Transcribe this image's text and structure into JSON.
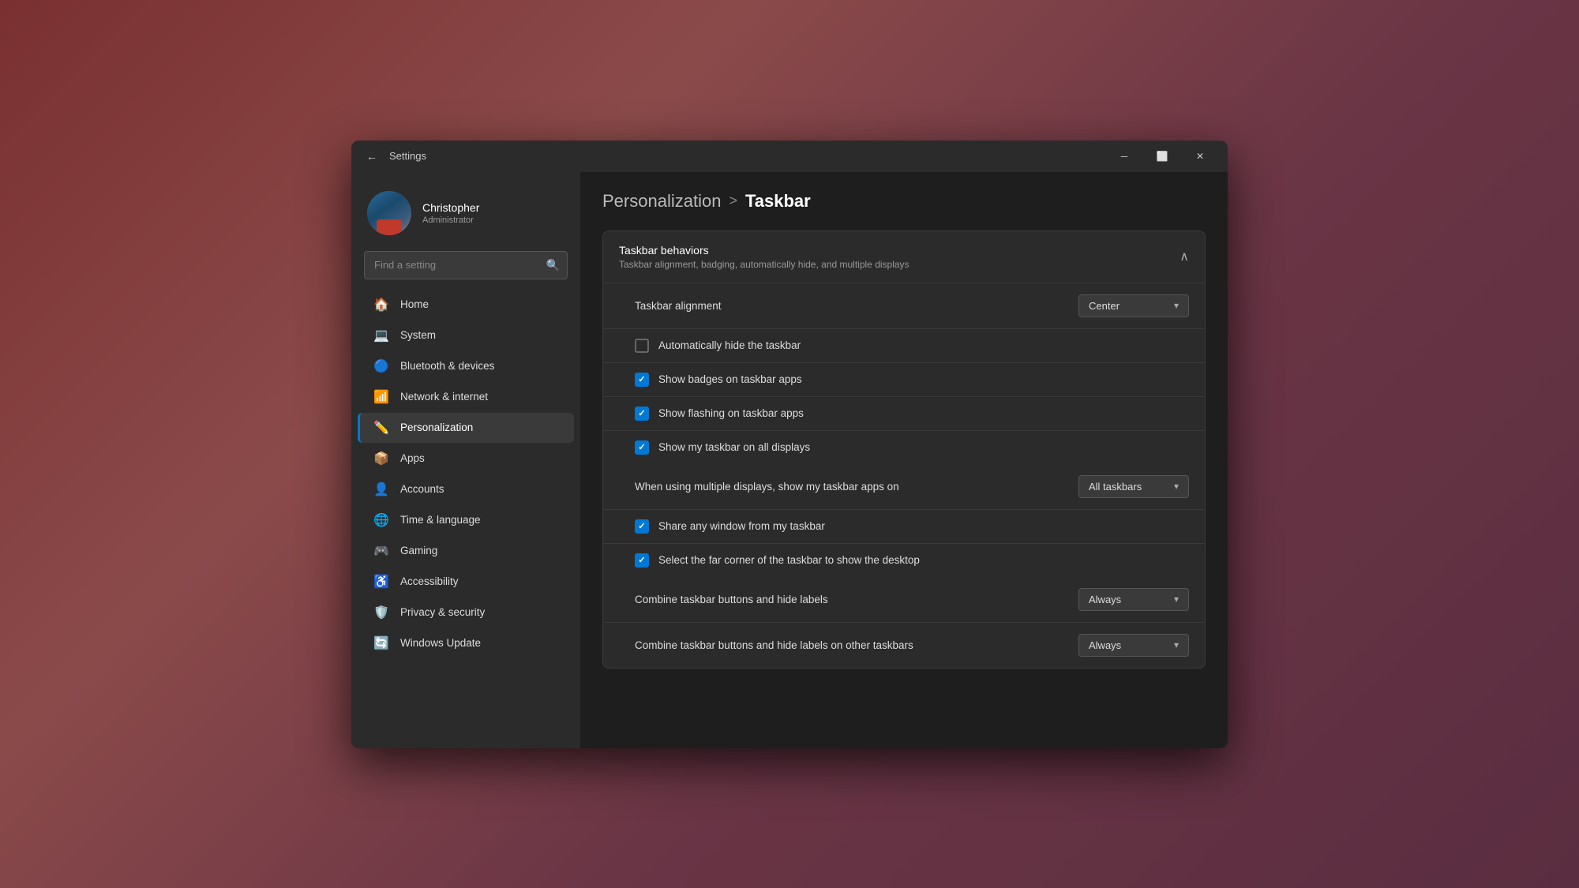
{
  "window": {
    "title": "Settings",
    "minimize_label": "─",
    "maximize_label": "⬜",
    "close_label": "✕"
  },
  "user": {
    "name": "Christopher",
    "status": "Administrator"
  },
  "search": {
    "placeholder": "Find a setting"
  },
  "breadcrumb": {
    "parent": "Personalization",
    "separator": ">",
    "current": "Taskbar"
  },
  "nav": {
    "items": [
      {
        "id": "home",
        "label": "Home",
        "icon": "🏠"
      },
      {
        "id": "system",
        "label": "System",
        "icon": "💻"
      },
      {
        "id": "bluetooth",
        "label": "Bluetooth & devices",
        "icon": "🔵"
      },
      {
        "id": "network",
        "label": "Network & internet",
        "icon": "📶"
      },
      {
        "id": "personalization",
        "label": "Personalization",
        "icon": "✏️",
        "active": true
      },
      {
        "id": "apps",
        "label": "Apps",
        "icon": "📦"
      },
      {
        "id": "accounts",
        "label": "Accounts",
        "icon": "👤"
      },
      {
        "id": "time",
        "label": "Time & language",
        "icon": "🌐"
      },
      {
        "id": "gaming",
        "label": "Gaming",
        "icon": "🎮"
      },
      {
        "id": "accessibility",
        "label": "Accessibility",
        "icon": "♿"
      },
      {
        "id": "privacy",
        "label": "Privacy & security",
        "icon": "🛡️"
      },
      {
        "id": "update",
        "label": "Windows Update",
        "icon": "🔄"
      }
    ]
  },
  "section": {
    "title": "Taskbar behaviors",
    "subtitle": "Taskbar alignment, badging, automatically hide, and multiple displays",
    "chevron": "∧"
  },
  "settings": {
    "alignment": {
      "label": "Taskbar alignment",
      "value": "Center"
    },
    "checkboxes": [
      {
        "id": "auto-hide",
        "label": "Automatically hide the taskbar",
        "checked": false
      },
      {
        "id": "badges",
        "label": "Show badges on taskbar apps",
        "checked": true
      },
      {
        "id": "flashing",
        "label": "Show flashing on taskbar apps",
        "checked": true
      },
      {
        "id": "all-displays",
        "label": "Show my taskbar on all displays",
        "checked": true
      }
    ],
    "multiple_display": {
      "label": "When using multiple displays, show my taskbar apps on",
      "value": "All taskbars"
    },
    "checkboxes2": [
      {
        "id": "share-window",
        "label": "Share any window from my taskbar",
        "checked": true
      },
      {
        "id": "far-corner",
        "label": "Select the far corner of the taskbar to show the desktop",
        "checked": true
      }
    ],
    "combine1": {
      "label": "Combine taskbar buttons and hide labels",
      "value": "Always"
    },
    "combine2": {
      "label": "Combine taskbar buttons and hide labels on other taskbars",
      "value": "Always"
    }
  }
}
